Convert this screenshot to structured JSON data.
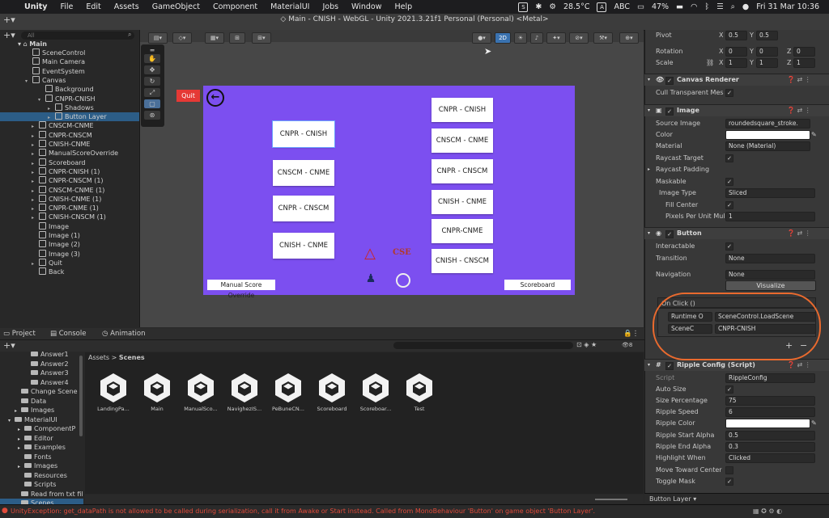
{
  "menubar": {
    "app": "Unity",
    "items": [
      "File",
      "Edit",
      "Assets",
      "GameObject",
      "Component",
      "MaterialUI",
      "Jobs",
      "Window",
      "Help"
    ],
    "temp": "28.5°C",
    "input": "ABC",
    "battery": "47%",
    "datetime": "Fri 31 Mar  10:36"
  },
  "toolbar": {
    "window_title": "Main - CNISH - WebGL - Unity 2021.3.21f1 Personal (Personal) <Metal>",
    "mode_2d": "2D"
  },
  "hierarchy": {
    "search_placeholder": "All",
    "scene": "Main",
    "rows": [
      {
        "label": "SceneControl"
      },
      {
        "label": "Main Camera"
      },
      {
        "label": "EventSystem"
      },
      {
        "label": "Canvas"
      },
      {
        "label": "Background"
      },
      {
        "label": "CNPR-CNISH"
      },
      {
        "label": "Shadows"
      },
      {
        "label": "Button Layer"
      },
      {
        "label": "CNSCM-CNME"
      },
      {
        "label": "CNPR-CNSCM"
      },
      {
        "label": "CNISH-CNME"
      },
      {
        "label": "ManualScoreOverride"
      },
      {
        "label": "Scoreboard"
      },
      {
        "label": "CNPR-CNISH (1)"
      },
      {
        "label": "CNPR-CNSCM (1)"
      },
      {
        "label": "CNSCM-CNME (1)"
      },
      {
        "label": "CNISH-CNME (1)"
      },
      {
        "label": "CNPR-CNME (1)"
      },
      {
        "label": "CNISH-CNSCM (1)"
      },
      {
        "label": "Image"
      },
      {
        "label": "Image (1)"
      },
      {
        "label": "Image (2)"
      },
      {
        "label": "Image (3)"
      },
      {
        "label": "Quit"
      },
      {
        "label": "Back"
      }
    ]
  },
  "scene": {
    "quit": "Quit",
    "left_buttons": [
      "CNPR - CNISH",
      "CNSCM - CNME",
      "CNPR - CNSCM",
      "CNISH - CNME"
    ],
    "right_buttons": [
      "CNPR - CNISH",
      "CNSCM - CNME",
      "CNPR - CNSCM",
      "CNISH - CNME",
      "CNPR-CNME",
      "CNISH - CNSCM"
    ],
    "manual_score": "Manual Score Override",
    "scoreboard": "Scoreboard",
    "logo_text": "CSE"
  },
  "inspector": {
    "pivot": {
      "label": "Pivot",
      "x": "0.5",
      "y": "0.5"
    },
    "rotation": {
      "label": "Rotation",
      "x": "0",
      "y": "0",
      "z": "0"
    },
    "scale": {
      "label": "Scale",
      "x": "1",
      "y": "1",
      "z": "1"
    },
    "canvas_renderer": "Canvas Renderer",
    "cull_transparent": "Cull Transparent Mes",
    "image": {
      "title": "Image",
      "source_image_label": "Source Image",
      "source_image": "roundedsquare_stroke.",
      "color_label": "Color",
      "material_label": "Material",
      "material": "None (Material)",
      "raycast_target": "Raycast Target",
      "raycast_padding": "Raycast Padding",
      "maskable": "Maskable",
      "image_type_label": "Image Type",
      "image_type": "Sliced",
      "fill_center": "Fill Center",
      "ppu_label": "Pixels Per Unit Mul",
      "ppu": "1"
    },
    "button": {
      "title": "Button",
      "interactable": "Interactable",
      "transition_label": "Transition",
      "transition": "None",
      "navigation_label": "Navigation",
      "navigation": "None",
      "visualize": "Visualize",
      "on_click": "On Click ()",
      "runtime": "Runtime O",
      "function": "SceneControl.LoadScene",
      "target": "SceneC",
      "arg": "CNPR-CNISH"
    },
    "ripple": {
      "title": "Ripple Config (Script)",
      "script_label": "Script",
      "script": "RippleConfig",
      "auto_size": "Auto Size",
      "size_pct_label": "Size Percentage",
      "size_pct": "75",
      "speed_label": "Ripple Speed",
      "speed": "6",
      "color_label": "Ripple Color",
      "start_alpha_label": "Ripple Start Alpha",
      "start_alpha": "0.5",
      "end_alpha_label": "Ripple End Alpha",
      "end_alpha": "0.3",
      "highlight_label": "Highlight When",
      "highlight": "Clicked",
      "move_toward": "Move Toward Center",
      "toggle_mask": "Toggle Mask"
    },
    "footer": "Button Layer"
  },
  "project": {
    "tabs": [
      "Project",
      "Console",
      "Animation"
    ],
    "breadcrumb": [
      "Assets",
      "Scenes"
    ],
    "count": "8",
    "tree": [
      {
        "label": "Answer1"
      },
      {
        "label": "Answer2"
      },
      {
        "label": "Answer3"
      },
      {
        "label": "Answer4"
      },
      {
        "label": "Change Scene"
      },
      {
        "label": "Data"
      },
      {
        "label": "Images"
      },
      {
        "label": "MaterialUI"
      },
      {
        "label": "ComponentP"
      },
      {
        "label": "Editor"
      },
      {
        "label": "Examples"
      },
      {
        "label": "Fonts"
      },
      {
        "label": "Images"
      },
      {
        "label": "Resources"
      },
      {
        "label": "Scripts"
      },
      {
        "label": "Read from txt fil"
      },
      {
        "label": "Scenes"
      }
    ],
    "assets": [
      "LandingPa...",
      "Main",
      "ManualSco...",
      "NavighezIS...",
      "PeBuneCN...",
      "Scoreboard",
      "Scoreboar...",
      "Test"
    ]
  },
  "status": "UnityException: get_dataPath is not allowed to be called during serialization, call it from Awake or Start instead. Called from MonoBehaviour 'Button' on game object 'Button Layer'."
}
